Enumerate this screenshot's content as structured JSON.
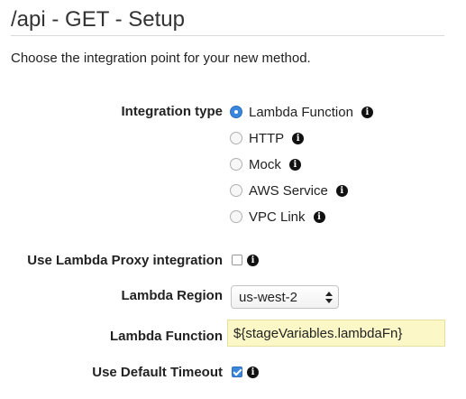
{
  "header": {
    "title": "/api - GET - Setup"
  },
  "intro_text": "Choose the integration point for your new method.",
  "integration_type": {
    "label": "Integration type",
    "options": [
      {
        "label": "Lambda Function",
        "selected": true
      },
      {
        "label": "HTTP",
        "selected": false
      },
      {
        "label": "Mock",
        "selected": false
      },
      {
        "label": "AWS Service",
        "selected": false
      },
      {
        "label": "VPC Link",
        "selected": false
      }
    ]
  },
  "lambda_proxy": {
    "label": "Use Lambda Proxy integration",
    "checked": false
  },
  "lambda_region": {
    "label": "Lambda Region",
    "value": "us-west-2"
  },
  "lambda_function": {
    "label": "Lambda Function",
    "value": "${stageVariables.lambdaFn}"
  },
  "default_timeout": {
    "label": "Use Default Timeout",
    "checked": true
  },
  "info_glyph": "i",
  "colors": {
    "accent": "#3b86dd",
    "input_highlight": "#fbf7c6",
    "title_text": "#333333"
  }
}
